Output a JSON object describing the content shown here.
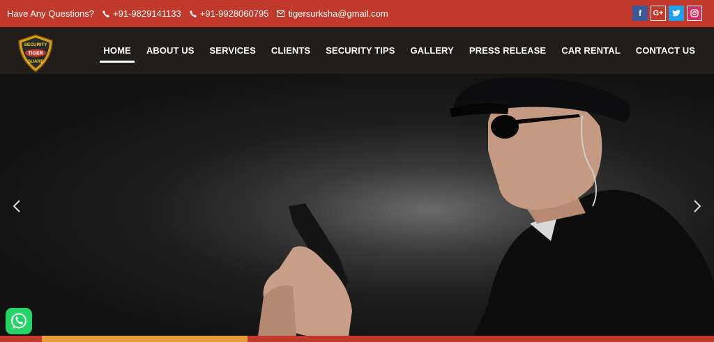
{
  "topbar": {
    "question": "Have Any Questions?",
    "phone1": "+91-9829141133",
    "phone2": "+91-9928060795",
    "email": "tigersurksha@gmail.com",
    "social": {
      "facebook": "f",
      "googleplus": "G+",
      "twitter": "twitter-icon",
      "instagram": "instagram-icon"
    }
  },
  "logo": {
    "line1": "SECURITY",
    "line2": "TIGER",
    "line3": "GUARD"
  },
  "menu": [
    {
      "label": "HOME"
    },
    {
      "label": "ABOUT US"
    },
    {
      "label": "SERVICES"
    },
    {
      "label": "CLIENTS"
    },
    {
      "label": "SECURITY TIPS"
    },
    {
      "label": "GALLERY"
    },
    {
      "label": "PRESS RELEASE"
    },
    {
      "label": "CAR RENTAL"
    },
    {
      "label": "CONTACT US"
    }
  ],
  "colors": {
    "topbar": "#c0392b",
    "nav": "#211d1b",
    "accent": "#e69b3a",
    "whatsapp": "#25d366"
  },
  "hero": {
    "icons": [
      "chevron-left-icon",
      "chevron-right-icon"
    ]
  }
}
